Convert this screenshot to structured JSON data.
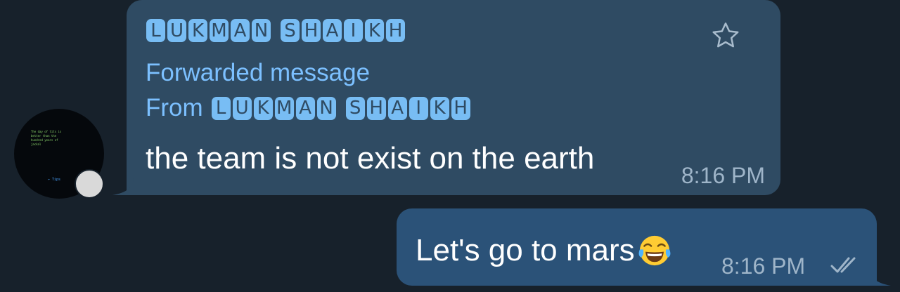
{
  "avatar": {
    "preview_text": "The day of tits is\nbetter than the\nhundred years of\njackal",
    "tips_text": "←  Tips"
  },
  "incoming": {
    "sender_letters_first": [
      "L",
      "U",
      "K",
      "M",
      "A",
      "N"
    ],
    "sender_letters_last": [
      "S",
      "H",
      "A",
      "I",
      "K",
      "H"
    ],
    "forwarded_label": "Forwarded message",
    "from_label": "From",
    "text": "the team is not exist on the earth",
    "time": "8:16 PM",
    "star_icon": "star-outline-icon"
  },
  "outgoing": {
    "text": "Let's go to mars",
    "emoji": "tears-of-joy-emoji",
    "time": "8:16 PM",
    "status_icon": "double-check-icon"
  },
  "colors": {
    "background": "#17212b",
    "incoming_bubble": "#2f4b63",
    "outgoing_bubble": "#2b5278",
    "accent": "#7cc0ff",
    "tile": "#78bdf4",
    "time": "#9fb5c9"
  }
}
